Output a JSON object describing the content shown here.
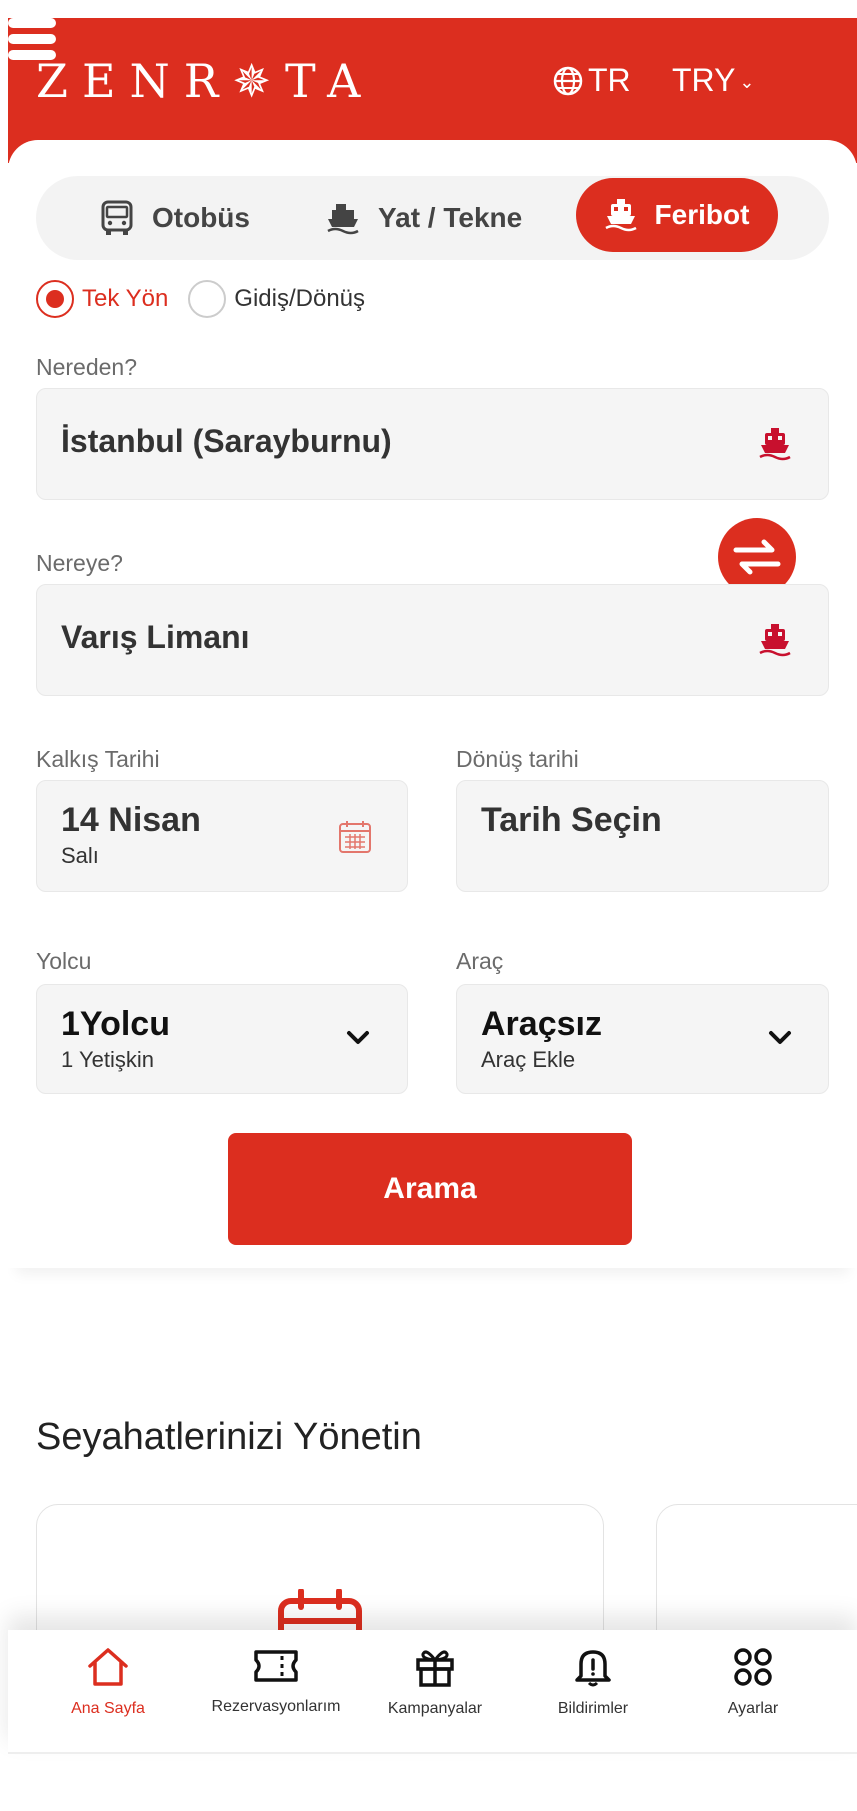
{
  "header": {
    "logo": "ZENR✵TA",
    "language": "TR",
    "currency": "TRY",
    "currency_chevron": "⌄"
  },
  "mode_tabs": [
    {
      "label": "Otobüs",
      "icon": "bus-icon",
      "active": false
    },
    {
      "label": "Yat / Tekne",
      "icon": "yacht-icon",
      "active": false
    },
    {
      "label": "Feribot",
      "icon": "ferry-icon",
      "active": true
    }
  ],
  "trip_type": {
    "one_way": "Tek Yön",
    "round_trip": "Gidiş/Dönüş",
    "selected": "one_way"
  },
  "from": {
    "label": "Nereden?",
    "value": "İstanbul (Sarayburnu)"
  },
  "to": {
    "label": "Nereye?",
    "value": "Varış Limanı"
  },
  "departure": {
    "label": "Kalkış Tarihi",
    "value": "14 Nisan",
    "sub": "Salı"
  },
  "return": {
    "label": "Dönüş tarihi",
    "value": "Tarih Seçin"
  },
  "passengers": {
    "label": "Yolcu",
    "value": "1Yolcu",
    "sub": "1 Yetişkin"
  },
  "vehicle": {
    "label": "Araç",
    "value": "Araçsız",
    "sub": "Araç Ekle"
  },
  "search_button": "Arama",
  "section_title": "Seyahatlerinizi Yönetin",
  "bottom_nav": [
    {
      "label": "Ana Sayfa",
      "icon": "home-icon",
      "active": true
    },
    {
      "label": "Rezervasyonlarım",
      "icon": "ticket-icon",
      "active": false
    },
    {
      "label": "Kampanyalar",
      "icon": "gift-icon",
      "active": false
    },
    {
      "label": "Bildirimler",
      "icon": "bell-icon",
      "active": false
    },
    {
      "label": "Ayarlar",
      "icon": "grid-icon",
      "active": false
    }
  ],
  "colors": {
    "brand": "#dc2e1f",
    "field_bg": "#f5f5f5"
  }
}
